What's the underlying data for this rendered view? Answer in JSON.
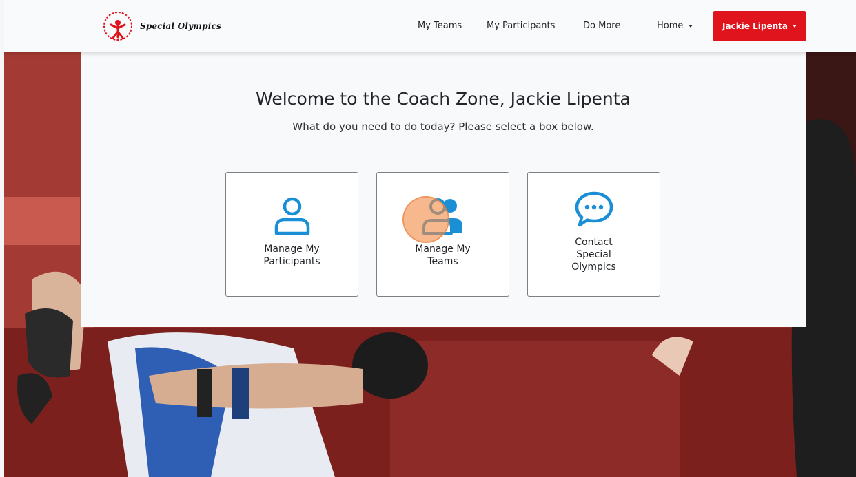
{
  "header": {
    "logo_text": "Special Olympics",
    "nav": {
      "my_teams": "My Teams",
      "my_participants": "My Participants",
      "do_more": "Do More",
      "home": "Home"
    },
    "user_menu_label": "Jackie Lipenta"
  },
  "main": {
    "welcome_title": "Welcome to the Coach Zone, Jackie Lipenta",
    "subtitle": "What do you need to do today? Please select a box below.",
    "cards": [
      {
        "label": "Manage My\nParticipants",
        "icon": "person-icon"
      },
      {
        "label": "Manage My\nTeams",
        "icon": "people-icon"
      },
      {
        "label": "Contact\nSpecial\nOlympics",
        "icon": "chat-bubble-icon"
      }
    ]
  },
  "colors": {
    "accent_red": "#e0141c",
    "icon_blue": "#1a8fd6",
    "header_bg": "#f9fafb"
  }
}
